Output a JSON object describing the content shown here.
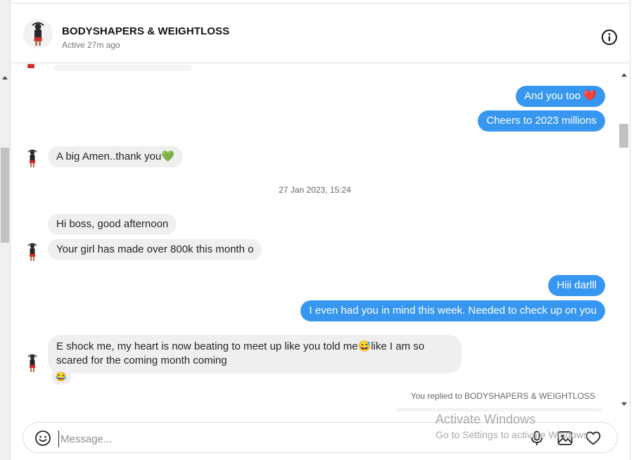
{
  "header": {
    "title": "BODYSHAPERS & WEIGHTLOSS",
    "status": "Active 27m ago",
    "info_icon": "info-circle-icon"
  },
  "messages": [
    {
      "id": "m1",
      "from": "me",
      "text": "And you too ❤️"
    },
    {
      "id": "m2",
      "from": "me",
      "text": "Cheers to 2023 millions"
    },
    {
      "id": "m3",
      "from": "them",
      "text": "A big Amen..thank you💚"
    },
    {
      "id": "m4",
      "from": "them",
      "text": "Hi boss, good afternoon"
    },
    {
      "id": "m5",
      "from": "them",
      "text": "Your girl has made over 800k this month o"
    },
    {
      "id": "m6",
      "from": "me",
      "text": "Hiii darlll"
    },
    {
      "id": "m7",
      "from": "me",
      "text": "I even had you in mind this week. Needed to check up on you"
    },
    {
      "id": "m8",
      "from": "them",
      "text": "E shock me, my heart is now beating to meet up like you told me😅like I am so scared for the coming month coming"
    },
    {
      "id": "m9",
      "from": "them",
      "text": "😂"
    }
  ],
  "timestamp": "27 Jan 2023, 15:24",
  "replied_label": "You replied to BODYSHAPERS & WEIGHTLOSS",
  "composer": {
    "placeholder": "Message...",
    "emoji_icon": "smiley-icon",
    "mic_icon": "microphone-icon",
    "image_icon": "image-icon",
    "like_icon": "heart-icon"
  },
  "watermark": {
    "line1": "Activate Windows",
    "line2": "Go to Settings to activate Windows."
  },
  "colors": {
    "outgoing_bubble": "#3797f0",
    "incoming_bubble": "#efefef",
    "border": "#dbdbdb"
  }
}
